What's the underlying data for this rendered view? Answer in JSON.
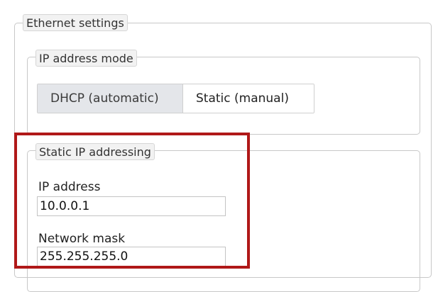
{
  "ethernet": {
    "legend": "Ethernet settings"
  },
  "ip_mode": {
    "legend": "IP address mode",
    "options": [
      {
        "label": "DHCP (automatic)",
        "selected": false
      },
      {
        "label": "Static (manual)",
        "selected": true
      }
    ]
  },
  "static_ip": {
    "legend": "Static IP addressing",
    "ip_address": {
      "label": "IP address",
      "value": "10.0.0.1"
    },
    "network_mask": {
      "label": "Network mask",
      "value": "255.255.255.0"
    }
  },
  "colors": {
    "highlight": "#b01818",
    "dhcp_background": "#e4e6ea",
    "static_background": "#ffffff"
  }
}
